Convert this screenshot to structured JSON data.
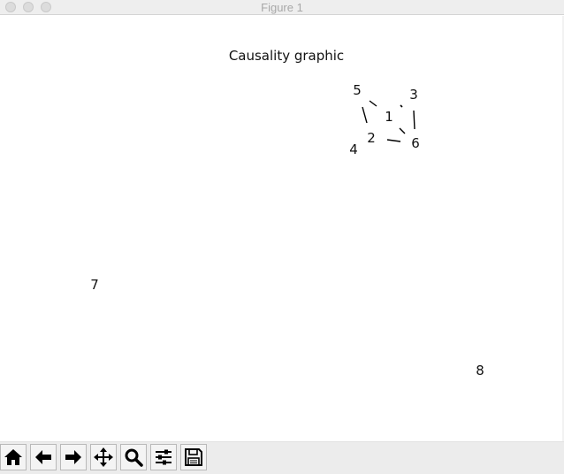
{
  "window": {
    "title": "Figure 1"
  },
  "figure": {
    "title": "Causality graphic",
    "nodes": [
      "1",
      "2",
      "3",
      "4",
      "5",
      "6",
      "7",
      "8"
    ]
  },
  "toolbar": {
    "buttons": [
      {
        "id": "home",
        "icon": "home-icon"
      },
      {
        "id": "back",
        "icon": "arrow-left-icon"
      },
      {
        "id": "forward",
        "icon": "arrow-right-icon"
      },
      {
        "id": "pan",
        "icon": "move-icon"
      },
      {
        "id": "zoom",
        "icon": "magnifier-icon"
      },
      {
        "id": "configure",
        "icon": "sliders-icon"
      },
      {
        "id": "save",
        "icon": "floppy-disk-icon"
      }
    ]
  }
}
